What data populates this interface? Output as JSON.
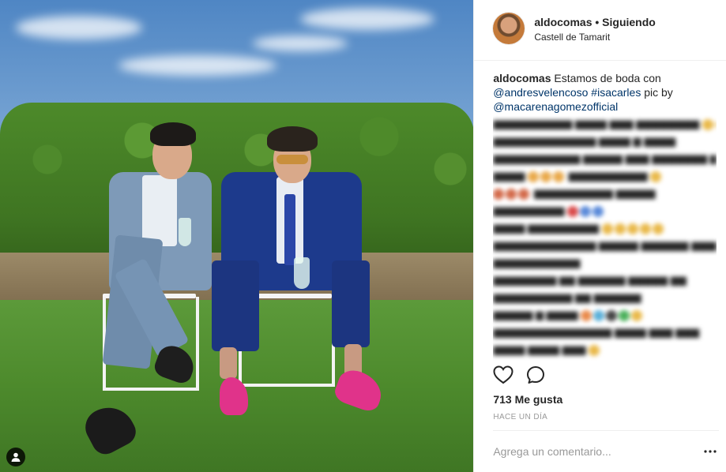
{
  "photo": {
    "description_icon": "person-tag-icon"
  },
  "header": {
    "username": "aldocomas",
    "separator": "•",
    "follow_status": "Siguiendo",
    "location": "Castell de Tamarit",
    "avatar_icon": "avatar-image"
  },
  "caption": {
    "username": "aldocomas",
    "text_1": "Estamos de boda con",
    "mention_1": "@andresvelencoso",
    "hashtag": "#isacarles",
    "text_2": "pic by",
    "mention_2": "@macarenagomezofficial"
  },
  "actions": {
    "like_icon": "heart-icon",
    "comment_icon": "comment-bubble-icon",
    "more_icon": "more-dots-icon"
  },
  "likes": "713 Me gusta",
  "time": "HACE UN DÍA",
  "comment_input": {
    "placeholder": "Agrega un comentario..."
  },
  "colors": {
    "text": "#262626",
    "link": "#003569",
    "muted": "#999999",
    "divider": "#efefef"
  }
}
